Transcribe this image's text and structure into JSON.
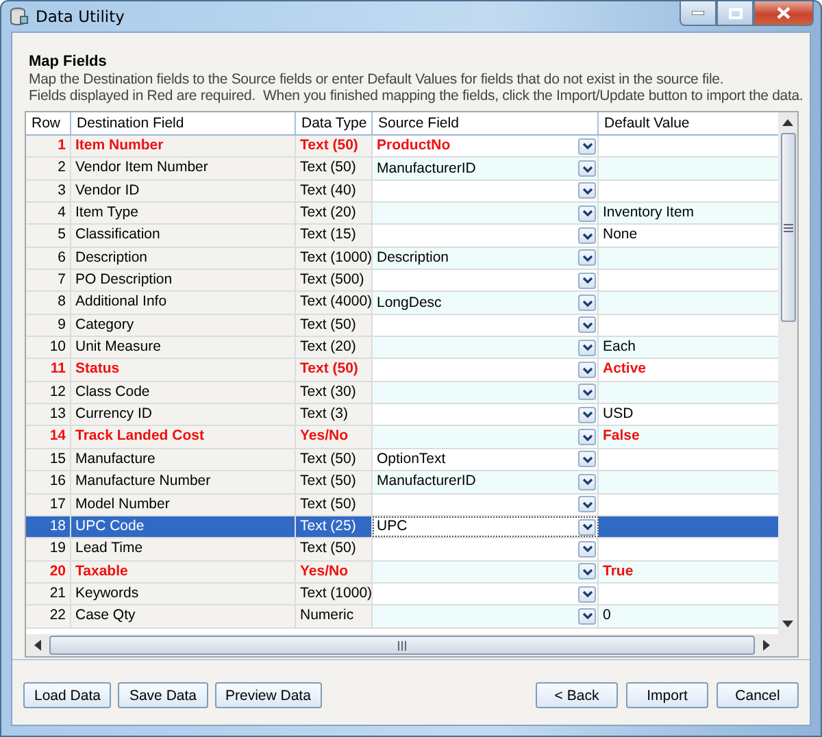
{
  "window": {
    "title": "Data Utility"
  },
  "header": {
    "title": "Map Fields",
    "lines": [
      "Map the Destination fields to the Source fields or enter Default Values for fields that do not exist in the source file.",
      "Fields displayed in Red are required.  When you finished mapping the fields, click the Import/Update button to import the data."
    ]
  },
  "table": {
    "columns": [
      "Row",
      "Destination Field",
      "Data Type",
      "Source Field",
      "Default Value"
    ],
    "rows": [
      {
        "row": "1",
        "field": "Item Number",
        "type": "Text (50)",
        "source": "ProductNo",
        "required": true,
        "selected": false
      },
      {
        "row": "2",
        "field": "Vendor Item Number",
        "type": "Text (50)",
        "source": "ManufacturerID",
        "required": false,
        "selected": false
      },
      {
        "row": "3",
        "field": "Vendor ID",
        "type": "Text (40)",
        "required": false,
        "selected": false
      },
      {
        "row": "4",
        "field": "Item Type",
        "type": "Text (20)",
        "default": "Inventory Item",
        "required": false,
        "selected": false
      },
      {
        "row": "5",
        "field": "Classification",
        "type": "Text (15)",
        "default": "None",
        "required": false,
        "selected": false
      },
      {
        "row": "6",
        "field": "Description",
        "type": "Text (1000)",
        "source": "Description",
        "required": false,
        "selected": false
      },
      {
        "row": "7",
        "field": "PO Description",
        "type": "Text (500)",
        "required": false,
        "selected": false
      },
      {
        "row": "8",
        "field": "Additional Info",
        "type": "Text (4000)",
        "source": "LongDesc",
        "required": false,
        "selected": false
      },
      {
        "row": "9",
        "field": "Category",
        "type": "Text (50)",
        "required": false,
        "selected": false
      },
      {
        "row": "10",
        "field": "Unit Measure",
        "type": "Text (20)",
        "default": "Each",
        "required": false,
        "selected": false
      },
      {
        "row": "11",
        "field": "Status",
        "type": "Text (50)",
        "default": "Active",
        "required": true,
        "selected": false
      },
      {
        "row": "12",
        "field": "Class Code",
        "type": "Text (30)",
        "required": false,
        "selected": false
      },
      {
        "row": "13",
        "field": "Currency ID",
        "type": "Text (3)",
        "default": "USD",
        "required": false,
        "selected": false
      },
      {
        "row": "14",
        "field": "Track Landed Cost",
        "type": "Yes/No",
        "default": "False",
        "required": true,
        "selected": false
      },
      {
        "row": "15",
        "field": "Manufacture",
        "type": "Text (50)",
        "source": "OptionText",
        "required": false,
        "selected": false
      },
      {
        "row": "16",
        "field": "Manufacture Number",
        "type": "Text (50)",
        "source": "ManufacturerID",
        "required": false,
        "selected": false
      },
      {
        "row": "17",
        "field": "Model Number",
        "type": "Text (50)",
        "required": false,
        "selected": false
      },
      {
        "row": "18",
        "field": "UPC Code",
        "type": "Text (25)",
        "source": "UPC",
        "required": false,
        "selected": true
      },
      {
        "row": "19",
        "field": "Lead Time",
        "type": "Text (50)",
        "required": false,
        "selected": false
      },
      {
        "row": "20",
        "field": "Taxable",
        "type": "Yes/No",
        "default": "True",
        "required": true,
        "selected": false
      },
      {
        "row": "21",
        "field": "Keywords",
        "type": "Text (1000)",
        "required": false,
        "selected": false
      },
      {
        "row": "22",
        "field": "Case Qty",
        "type": "Numeric",
        "default": "0",
        "required": false,
        "selected": false
      }
    ]
  },
  "footer": {
    "left": [
      "Load Data",
      "Save Data",
      "Preview Data"
    ],
    "right": [
      "< Back",
      "Import",
      "Cancel"
    ]
  }
}
